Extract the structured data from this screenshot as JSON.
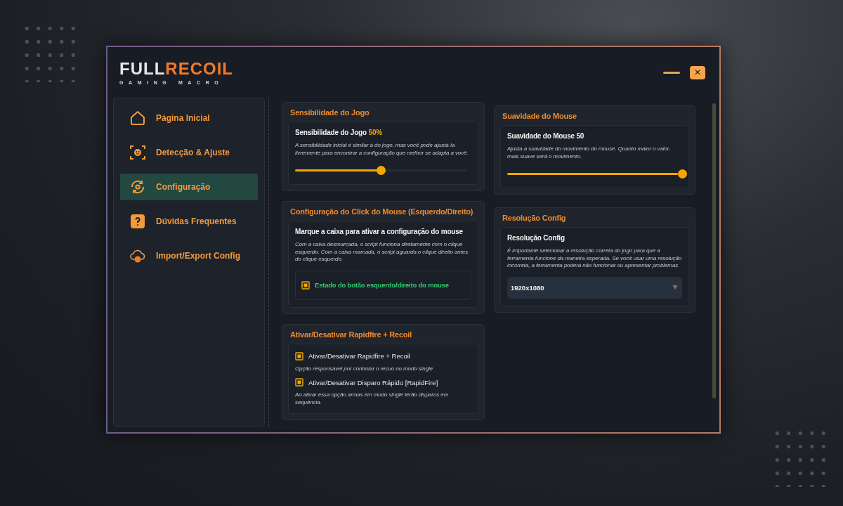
{
  "logo": {
    "word_1": "FULL",
    "word_2": "RECOIL",
    "tagline": "GAMING MACRO"
  },
  "window_controls": {
    "close": "✕"
  },
  "sidebar": {
    "items": [
      {
        "label": "Página Inicial",
        "selected": false
      },
      {
        "label": "Detecção & Ajuste",
        "selected": false
      },
      {
        "label": "Configuração",
        "selected": true
      },
      {
        "label": "Dúvidas Frequentes",
        "selected": false
      },
      {
        "label": "Import/Export Config",
        "selected": false
      }
    ]
  },
  "columns": [
    {
      "cards": [
        {
          "kind": "slider",
          "title": "Sensibilidade do Jogo",
          "heading": "Sensibilidade do Jogo",
          "value": "50%",
          "description": "A sensibilidade inicial é similar à do jogo, mas você pode ajustá-la livremente para encontrar a configuração que melhor se adapta a você.",
          "level": 0.5
        },
        {
          "kind": "checkbox",
          "title": "Configuração do Click do Mouse (Esquerdo/Direito)",
          "heading": "Marque a caixa para ativar a configuração do mouse",
          "description": "Com a caixa desmarcada, o script funciona diretamente com o clique esquerdo. Com a caixa marcada, o script aguarda o clique direito antes do clique esquerdo.",
          "option": {
            "label": "Estado do botão esquerdo/direito do mouse",
            "checked": true
          }
        },
        {
          "kind": "toggles",
          "title": "Ativar/Desativar Rapidfire + Recoil",
          "options": [
            {
              "label": "Ativar/Desativar Rapidfire + Recoil",
              "checked": true,
              "description": "Opção responsável por controlar o recuo no modo single"
            },
            {
              "label": "Ativar/Desativar Disparo Rápido [RapidFire]",
              "checked": true,
              "description": "Ao ativar essa opção armas em modo single terão disparos em sequência."
            }
          ]
        }
      ]
    },
    {
      "cards": [
        {
          "kind": "slider",
          "title": "Suavidade do Mouse",
          "heading": "Suavidade do Mouse 50",
          "description": "Ajusta a suavidade do movimento do mouse. Quanto maior o valor, mais suave será o movimento.",
          "level": 1.0
        },
        {
          "kind": "select",
          "title": "Resolução Config",
          "heading": "Resolução Config",
          "description": "É importante selecionar a resolução correta do jogo para que a ferramenta funcione da maneira esperada. Se você usar uma resolução incorreta, a ferramenta poderá não funcionar ou apresentar problemas",
          "selected_value": "1920x1080"
        }
      ]
    }
  ]
}
